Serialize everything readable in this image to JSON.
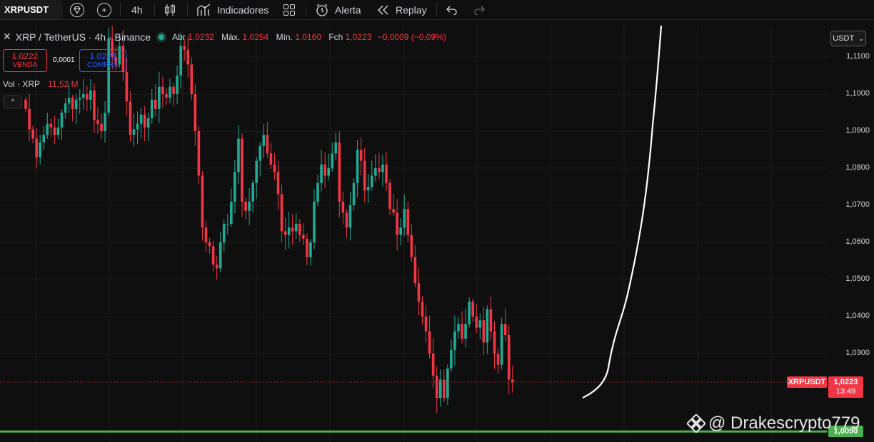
{
  "toolbar": {
    "symbol": "XRPUSDT",
    "timeframe": "4h",
    "indicators_label": "Indicadores",
    "alert_label": "Alerta",
    "replay_label": "Replay"
  },
  "legend": {
    "title": "XRP / TetherUS · 4h · Binance",
    "open_label": "Abr",
    "open": "1,0232",
    "high_label": "Máx.",
    "high": "1,0254",
    "low_label": "Mín.",
    "low": "1,0160",
    "close_label": "Fch",
    "close": "1,0223",
    "change": "−0,0009 (−0,09%)"
  },
  "quote": {
    "sell_price": "1,0222",
    "sell_label": "VENDA",
    "spread": "0,0001",
    "buy_price": "1,0223",
    "buy_label": "COMPRA"
  },
  "volume": {
    "label": "Vol · XRP",
    "value": "11,52 M"
  },
  "currency_button": "USDT",
  "price_axis": {
    "ticks": [
      "1,1100",
      "1,1000",
      "1,0900",
      "1,0800",
      "1,0700",
      "1,0600",
      "1,0500",
      "1,0400",
      "1,0300"
    ],
    "tick_values": [
      1.11,
      1.1,
      1.09,
      1.08,
      1.07,
      1.06,
      1.05,
      1.04,
      1.03
    ]
  },
  "last_price": {
    "symbol": "XRPUSDT",
    "price": "1,0223",
    "countdown": "13:49",
    "value": 1.0223
  },
  "support_line": {
    "price": "1,0090",
    "value": 1.009,
    "color": "#4caf50"
  },
  "colors": {
    "up": "#22ab94",
    "down": "#f23645",
    "background": "#0f0f0f"
  },
  "watermark": "@ Drakescrypto779",
  "chart_data": {
    "type": "candlestick",
    "symbol": "XRPUSDT",
    "timeframe": "4h",
    "ylim": [
      1.0085,
      1.116
    ],
    "closes": [
      1.096,
      1.0905,
      1.088,
      1.083,
      1.087,
      1.089,
      1.092,
      1.091,
      1.089,
      1.091,
      1.095,
      1.0975,
      1.099,
      1.096,
      1.0985,
      1.099,
      1.1,
      1.0985,
      1.101,
      1.093,
      1.092,
      1.09,
      1.095,
      1.115,
      1.11,
      1.108,
      1.113,
      1.106,
      1.098,
      1.089,
      1.0905,
      1.092,
      1.0945,
      1.091,
      1.0935,
      1.0985,
      1.096,
      1.102,
      1.1,
      1.099,
      1.102,
      1.1,
      1.105,
      1.113,
      1.112,
      1.108,
      1.1,
      1.09,
      1.078,
      1.064,
      1.06,
      1.059,
      1.054,
      1.053,
      1.06,
      1.065,
      1.065,
      1.071,
      1.079,
      1.088,
      1.071,
      1.0685,
      1.071,
      1.076,
      1.082,
      1.086,
      1.089,
      1.084,
      1.081,
      1.079,
      1.073,
      1.063,
      1.062,
      1.064,
      1.063,
      1.065,
      1.062,
      1.061,
      1.056,
      1.06,
      1.071,
      1.076,
      1.081,
      1.078,
      1.08,
      1.084,
      1.087,
      1.071,
      1.068,
      1.064,
      1.07,
      1.076,
      1.085,
      1.082,
      1.074,
      1.075,
      1.078,
      1.08,
      1.079,
      1.081,
      1.076,
      1.069,
      1.068,
      1.062,
      1.064,
      1.069,
      1.062,
      1.056,
      1.049,
      1.044,
      1.04,
      1.036,
      1.03,
      1.024,
      1.018,
      1.023,
      1.018,
      1.026,
      1.031,
      1.036,
      1.038,
      1.034,
      1.038,
      1.044,
      1.04,
      1.037,
      1.039,
      1.033,
      1.042,
      1.036,
      1.03,
      1.027,
      1.038,
      1.035,
      1.023,
      1.0223
    ]
  }
}
